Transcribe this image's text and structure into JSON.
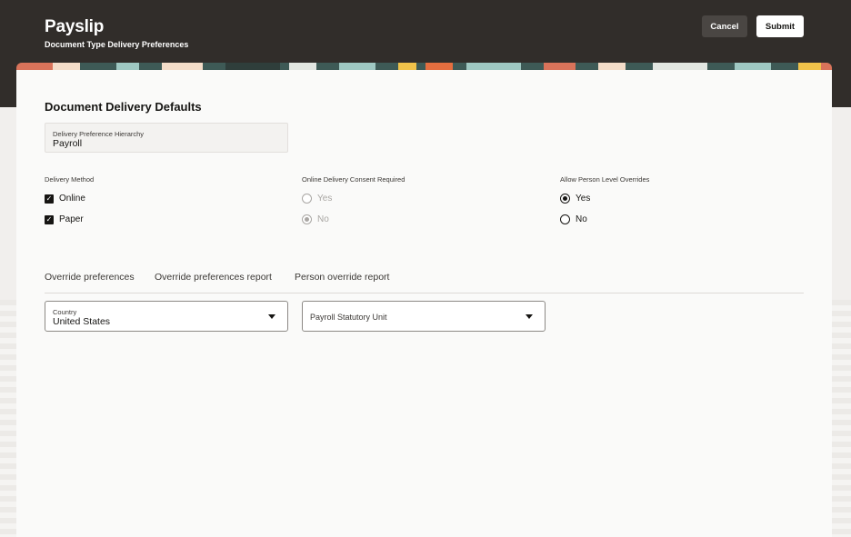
{
  "header": {
    "title": "Payslip",
    "subtitle": "Document Type Delivery Preferences",
    "cancel_label": "Cancel",
    "submit_label": "Submit",
    "background_color": "#312d2a"
  },
  "section": {
    "title": "Document Delivery Defaults",
    "hierarchy_label": "Delivery Preference Hierarchy",
    "hierarchy_value": "Payroll"
  },
  "delivery_method": {
    "label": "Delivery Method",
    "options": [
      {
        "label": "Online",
        "checked": true
      },
      {
        "label": "Paper",
        "checked": true
      }
    ]
  },
  "consent": {
    "label": "Online Delivery Consent Required",
    "options": [
      {
        "label": "Yes",
        "selected": false,
        "disabled": true
      },
      {
        "label": "No",
        "selected": true,
        "disabled": true
      }
    ]
  },
  "overrides": {
    "label": "Allow Person Level Overrides",
    "options": [
      {
        "label": "Yes",
        "selected": true
      },
      {
        "label": "No",
        "selected": false
      }
    ]
  },
  "tabs": [
    {
      "label": "Override preferences"
    },
    {
      "label": "Override preferences report"
    },
    {
      "label": "Person override report"
    }
  ],
  "filters": {
    "country_label": "Country",
    "country_value": "United States",
    "psu_placeholder": "Payroll Statutory Unit"
  }
}
